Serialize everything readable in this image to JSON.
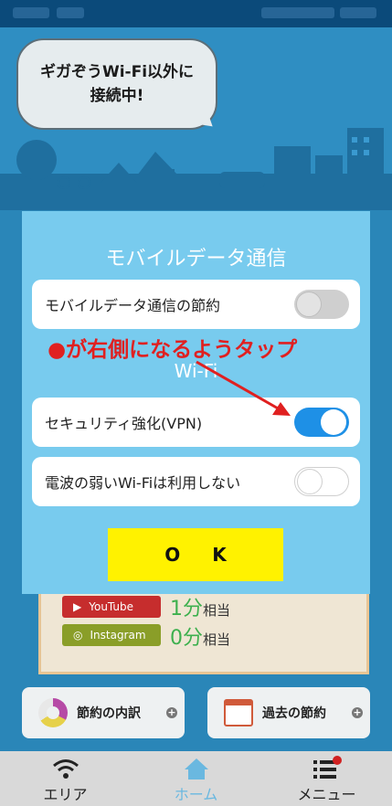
{
  "background": {
    "bubble_line1": "ギガぞうWi-Fi以外に",
    "bubble_line2": "接続中!",
    "stats": [
      {
        "service": "YouTube",
        "value": "1分",
        "unit": "相当"
      },
      {
        "service": "Instagram",
        "value": "0分",
        "unit": "相当"
      }
    ],
    "cards": [
      {
        "label": "節約の内訳",
        "icon": "pie-chart-icon"
      },
      {
        "label": "過去の節約",
        "icon": "calendar-icon"
      }
    ]
  },
  "dialog": {
    "title": "モバイルデータ通信",
    "rows": {
      "data_saving": {
        "label": "モバイルデータ通信の節約",
        "state": "off"
      },
      "vpn": {
        "label": "セキュリティ強化(VPN)",
        "state": "on"
      },
      "weak_wifi": {
        "label": "電波の弱いWi-Fiは利用しない",
        "state": "off"
      }
    },
    "wifi_section": "Wi-Fi",
    "ok_label": "O K"
  },
  "annotation": {
    "text": "●が右側になるようタップ",
    "color": "#e02020"
  },
  "tabbar": {
    "tabs": [
      {
        "label": "エリア",
        "icon": "wifi-icon"
      },
      {
        "label": "ホーム",
        "icon": "home-icon",
        "active": true
      },
      {
        "label": "メニュー",
        "icon": "menu-icon"
      }
    ]
  },
  "colors": {
    "dialog_bg": "#78cbee",
    "toggle_on": "#1e90e6",
    "ok_button": "#fff200",
    "tab_active": "#6ab8e0"
  }
}
